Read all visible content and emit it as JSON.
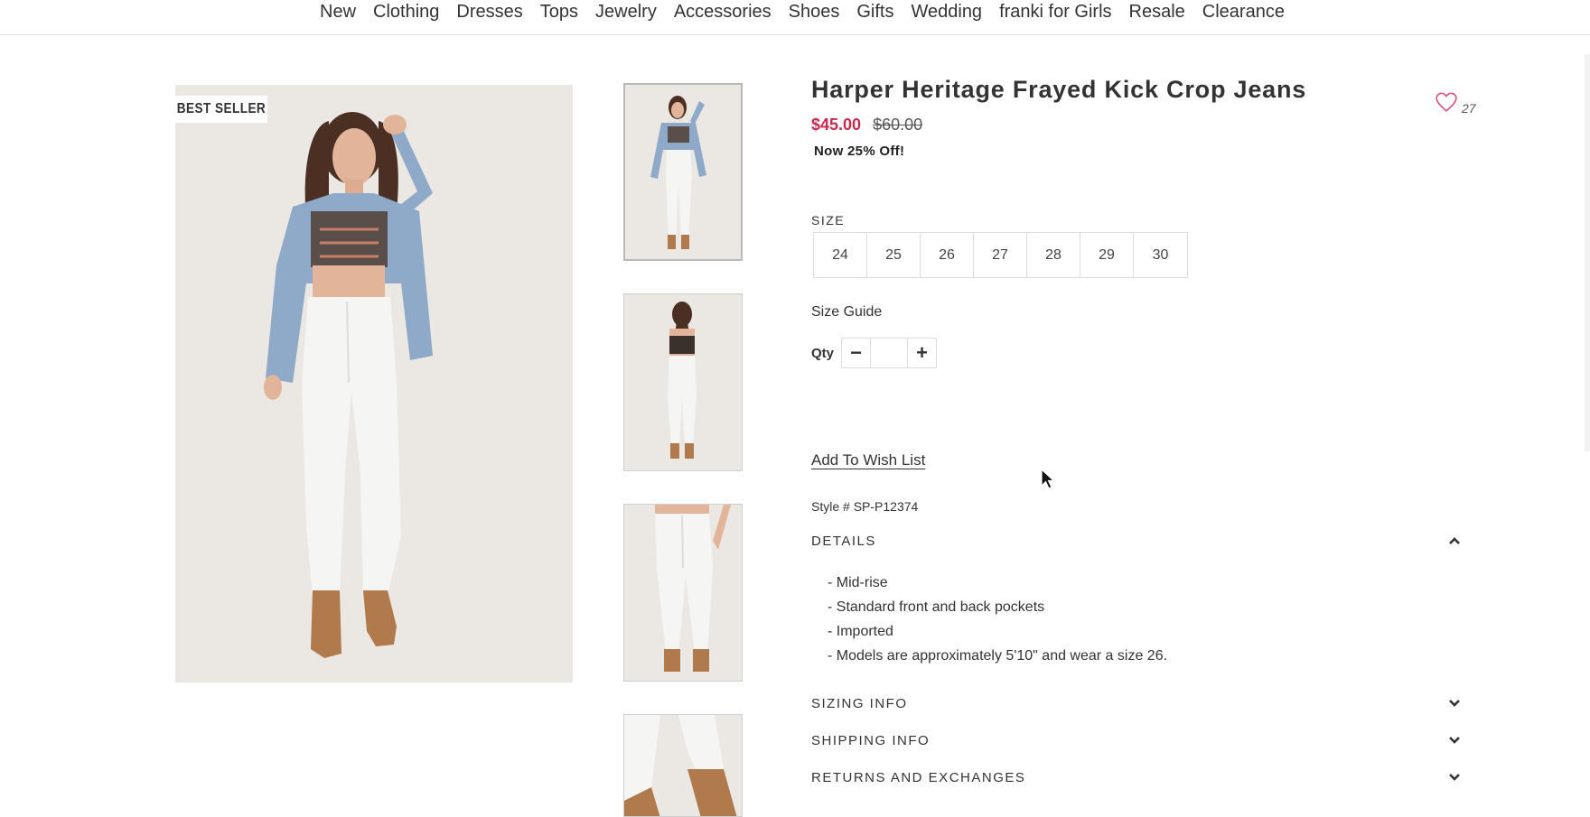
{
  "nav": {
    "items": [
      "New",
      "Clothing",
      "Dresses",
      "Tops",
      "Jewelry",
      "Accessories",
      "Shoes",
      "Gifts",
      "Wedding",
      "franki for Girls",
      "Resale",
      "Clearance"
    ]
  },
  "gallery": {
    "badge": "BEST SELLER",
    "thumbnail_count": 4,
    "active_thumbnail": 1
  },
  "product": {
    "title": "Harper Heritage Frayed Kick Crop Jeans",
    "price_sale": "$45.00",
    "price_original": "$60.00",
    "discount_text": "Now 25% Off!",
    "wishlist_count": "27",
    "size_label": "SIZE",
    "sizes": [
      "24",
      "25",
      "26",
      "27",
      "28",
      "29",
      "30"
    ],
    "size_guide": "Size Guide",
    "qty_label": "Qty",
    "qty_minus": "−",
    "qty_plus": "+",
    "qty_value": "",
    "add_to_wishlist": "Add To Wish List",
    "style_number": "Style # SP-P12374"
  },
  "accordion": {
    "details": {
      "title": "DETAILS",
      "expanded": true,
      "items": [
        "- Mid-rise",
        "- Standard front and back pockets",
        "- Imported",
        "- Models are approximately 5'10\" and wear a size 26."
      ]
    },
    "sizing": {
      "title": "SIZING INFO",
      "expanded": false
    },
    "shipping": {
      "title": "SHIPPING INFO",
      "expanded": false
    },
    "returns": {
      "title": "RETURNS AND EXCHANGES",
      "expanded": false
    }
  },
  "colors": {
    "sale_price": "#c8294f",
    "heart": "#d9537a",
    "denim": "#8fa9c9",
    "jeans": "#f4f4f2",
    "boots": "#b07a4c"
  }
}
